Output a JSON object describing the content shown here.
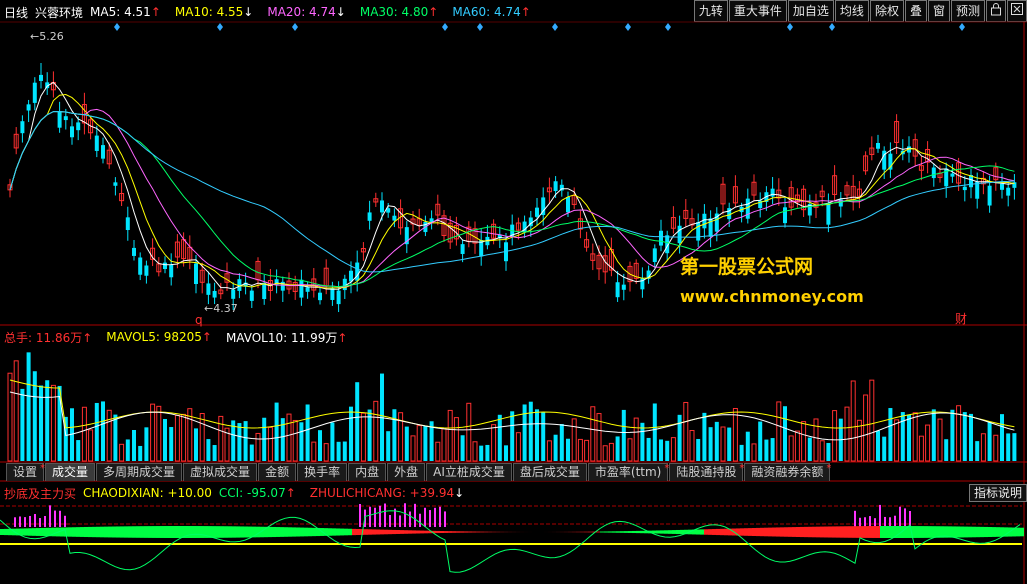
{
  "main_legend": {
    "period": "日线",
    "stock_name": "兴蓉环境",
    "ma5": {
      "label": "MA5: 4.51",
      "arrow": "↑",
      "color": "#ffffff"
    },
    "ma10": {
      "label": "MA10: 4.55",
      "arrow": "↓",
      "color": "#ffff00"
    },
    "ma20": {
      "label": "MA20: 4.74",
      "arrow": "↓",
      "color": "#ff66ff"
    },
    "ma30": {
      "label": "MA30: 4.80",
      "arrow": "↑",
      "color": "#00ff66"
    },
    "ma60": {
      "label": "MA60: 4.74",
      "arrow": "↑",
      "color": "#33ccff"
    }
  },
  "toolbar": {
    "items": [
      "九转",
      "重大事件",
      "加自选",
      "均线",
      "除权",
      "叠",
      "窗",
      "预测"
    ]
  },
  "price_markers": {
    "high": "5.26",
    "low": "4.37",
    "q": "q",
    "cai": "财"
  },
  "watermark": {
    "line1": "第一股票公式网",
    "line2": "www.chnmoney.com"
  },
  "volume_legend": {
    "total": {
      "label": "总手: 11.86万",
      "arrow": "↑",
      "color": "#ff3030"
    },
    "mavol5": {
      "label": "MAVOL5: 98205",
      "arrow": "↑",
      "color": "#ffff00"
    },
    "mavol10": {
      "label": "MAVOL10: 11.99万",
      "arrow": "↑",
      "color": "#ffffff"
    }
  },
  "tabs": [
    {
      "label": "设置",
      "active": false,
      "mark": true
    },
    {
      "label": "成交量",
      "active": true,
      "mark": false
    },
    {
      "label": "多周期成交量",
      "active": false,
      "mark": false
    },
    {
      "label": "虚拟成交量",
      "active": false,
      "mark": false
    },
    {
      "label": "金额",
      "active": false,
      "mark": false
    },
    {
      "label": "换手率",
      "active": false,
      "mark": false
    },
    {
      "label": "内盘",
      "active": false,
      "mark": false
    },
    {
      "label": "外盘",
      "active": false,
      "mark": false
    },
    {
      "label": "AI立桩成交量",
      "active": false,
      "mark": false
    },
    {
      "label": "盘后成交量",
      "active": false,
      "mark": false
    },
    {
      "label": "市盈率(ttm)",
      "active": false,
      "mark": true
    },
    {
      "label": "陆股通持股",
      "active": false,
      "mark": true
    },
    {
      "label": "融资融券余额",
      "active": false,
      "mark": true
    }
  ],
  "indicator_legend": {
    "name": "抄底及主力买",
    "chaodixian": {
      "label": "CHAODIXIAN: +10.00",
      "color": "#ffff00"
    },
    "cci": {
      "label": "CCI: -95.07",
      "arrow": "↑",
      "color": "#00ff66"
    },
    "zhulichicang": {
      "label": "ZHULICHICANG: +39.94",
      "arrow": "↓",
      "color": "#ff3030"
    }
  },
  "indicator_button": "指标说明",
  "colors": {
    "up": "#ff3030",
    "down": "#00e5ff",
    "grid_red": "#aa0000"
  }
}
